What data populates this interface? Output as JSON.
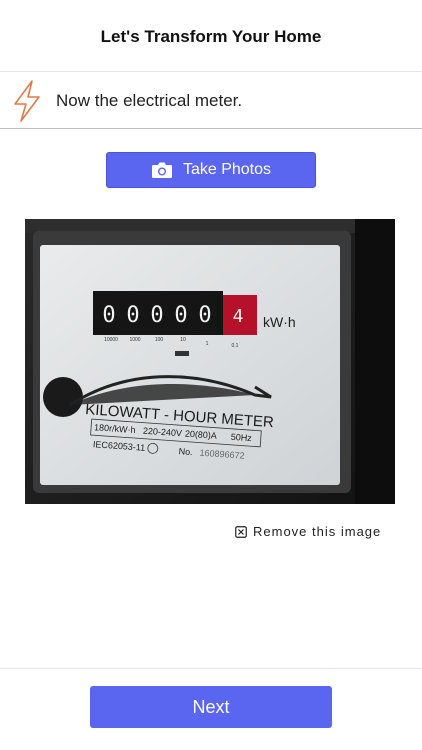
{
  "header": {
    "title": "Let's Transform Your Home"
  },
  "step": {
    "icon": "lightning-bolt-icon",
    "text": "Now the electrical meter."
  },
  "take_photos": {
    "icon": "camera-icon",
    "label": "Take Photos"
  },
  "photo": {
    "digits": [
      "0",
      "0",
      "0",
      "0",
      "0"
    ],
    "red_digit": "4",
    "unit": "kW·h",
    "scale_labels": [
      "10000",
      "1000",
      "100",
      "10",
      "1",
      "0.1"
    ],
    "title": "KILOWATT - HOUR METER",
    "spec_row1": [
      "180r/kW·h",
      "220-240V",
      "20(80)A",
      "50Hz"
    ],
    "spec_row2_std": "IEC62053-11",
    "serial_label": "No.",
    "serial": "160896672"
  },
  "remove": {
    "icon": "remove-image-icon",
    "label": "Remove this image"
  },
  "footer": {
    "next_label": "Next"
  },
  "colors": {
    "accent": "#5b66f0",
    "bolt": "#e07a4a"
  }
}
